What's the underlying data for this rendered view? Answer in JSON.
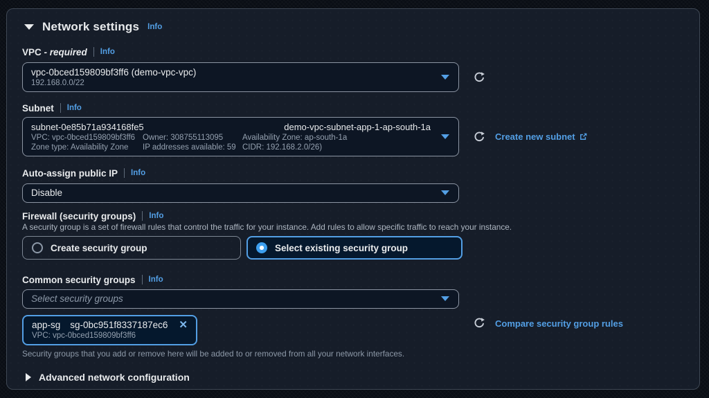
{
  "panel": {
    "title": "Network settings",
    "info": "Info"
  },
  "vpc": {
    "label": "VPC",
    "required_suffix": "- required",
    "info": "Info",
    "value": "vpc-0bced159809bf3ff6 (demo-vpc-vpc)",
    "cidr": "192.168.0.0/22"
  },
  "subnet": {
    "label": "Subnet",
    "info": "Info",
    "id": "subnet-0e85b71a934168fe5",
    "name": "demo-vpc-subnet-app-1-ap-south-1a",
    "details": [
      [
        "VPC: vpc-0bced159809bf3ff6",
        "Owner: 308755113095",
        "Availability Zone: ap-south-1a"
      ],
      [
        "Zone type: Availability Zone",
        "IP addresses available: 59",
        "CIDR: 192.168.2.0/26)"
      ]
    ],
    "create_link": "Create new subnet"
  },
  "auto_assign_ip": {
    "label": "Auto-assign public IP",
    "info": "Info",
    "value": "Disable"
  },
  "firewall": {
    "label": "Firewall (security groups)",
    "info": "Info",
    "description": "A security group is a set of firewall rules that control the traffic for your instance. Add rules to allow specific traffic to reach your instance.",
    "options": [
      {
        "label": "Create security group",
        "selected": false
      },
      {
        "label": "Select existing security group",
        "selected": true
      }
    ]
  },
  "common_sg": {
    "label": "Common security groups",
    "info": "Info",
    "placeholder": "Select security groups",
    "token": {
      "name": "app-sg",
      "id": "sg-0bc951f8337187ec6",
      "remove_icon": "✕",
      "vpc": "VPC: vpc-0bced159809bf3ff6"
    },
    "compare_link": "Compare security group rules",
    "helper": "Security groups that you add or remove here will be added to or removed from all your network interfaces."
  },
  "advanced": {
    "label": "Advanced network configuration"
  },
  "colors": {
    "accent_link": "#539fe5",
    "card_bg": "#161d29",
    "field_bg": "#0d1624",
    "field_border": "#8c95a3",
    "selected_tile_bg": "#05182d",
    "text_primary": "#e9ebed",
    "text_secondary": "#95a1b0"
  }
}
